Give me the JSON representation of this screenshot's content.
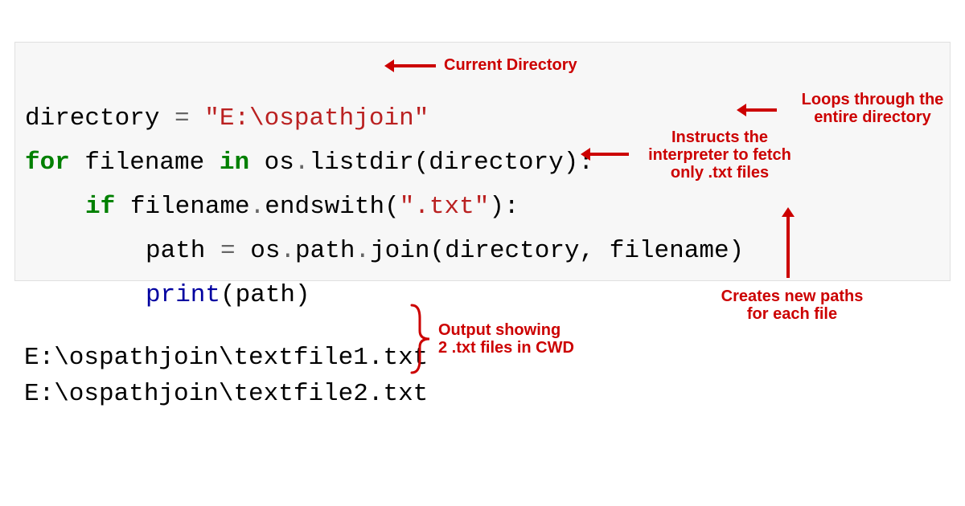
{
  "code": {
    "line1": {
      "var": "directory ",
      "eq": "=",
      "sp": " ",
      "str": "\"E:\\ospathjoin\""
    },
    "line2": {
      "for": "for",
      "mid1": " filename ",
      "in": "in",
      "mid2": " os",
      "dot1": ".",
      "attr1": "listdir(directory):"
    },
    "line3": {
      "if": "if",
      "mid1": " filename",
      "dot1": ".",
      "attr1": "endswith(",
      "str": "\".txt\"",
      "close": "):"
    },
    "line4": {
      "text1": "path ",
      "eq": "=",
      "text2": " os",
      "dot1": ".",
      "attr1": "path",
      "dot2": ".",
      "attr2": "join(directory, filename)"
    },
    "line5": {
      "fn": "print",
      "args": "(path)"
    }
  },
  "output": {
    "line1": "E:\\ospathjoin\\textfile1.txt",
    "line2": "E:\\ospathjoin\\textfile2.txt"
  },
  "annotations": {
    "currentDir": "Current Directory",
    "loops": "Loops through the\nentire directory",
    "instructs": "Instructs the\ninterpreter to fetch\nonly .txt files",
    "creates": "Creates new paths\nfor each file",
    "outputNote": "Output showing\n2 .txt files in CWD"
  }
}
